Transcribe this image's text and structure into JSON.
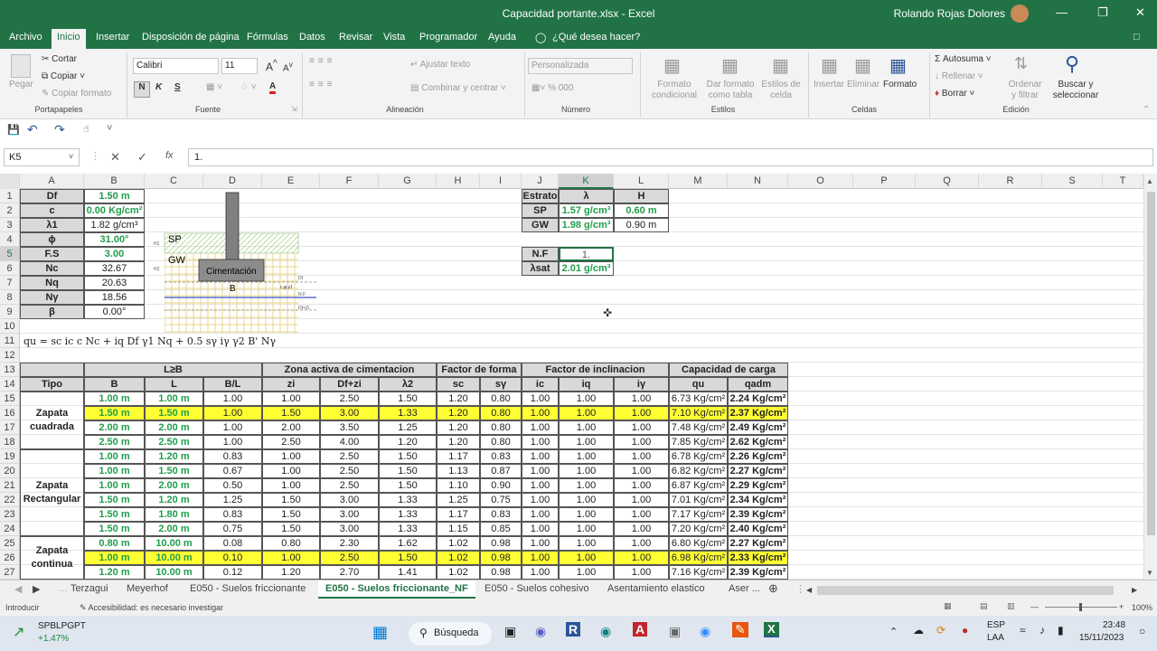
{
  "window": {
    "title": "Capacidad portante.xlsx - Excel",
    "user": "Rolando Rojas Dolores"
  },
  "menu": [
    "Archivo",
    "Inicio",
    "Insertar",
    "Disposición de página",
    "Fórmulas",
    "Datos",
    "Revisar",
    "Vista",
    "Programador",
    "Ayuda",
    "¿Qué desea hacer?"
  ],
  "ribbon": {
    "pegar": "Pegar",
    "cortar": "Cortar",
    "copiar": "Copiar",
    "copiar_formato": "Copiar formato",
    "portapapeles": "Portapapeles",
    "font_name": "Calibri",
    "font_size": "11",
    "fuente": "Fuente",
    "ajustar": "Ajustar texto",
    "combinar": "Combinar y centrar",
    "alineacion": "Alineación",
    "formato_num": "Personalizada",
    "numero": "Número",
    "formato_cond": "Formato condicional",
    "dar_formato": "Dar formato como tabla",
    "estilos_celda": "Estilos de celda",
    "estilos": "Estilos",
    "insertar": "Insertar",
    "eliminar": "Eliminar",
    "formato": "Formato",
    "celdas": "Celdas",
    "autosuma": "Autosuma",
    "rellenar": "Rellenar",
    "borrar": "Borrar",
    "ordenar": "Ordenar y filtrar",
    "buscar": "Buscar y seleccionar",
    "edicion": "Edición"
  },
  "formula_bar": {
    "name_box": "K5",
    "value": "1."
  },
  "columns": [
    "A",
    "B",
    "C",
    "D",
    "E",
    "F",
    "G",
    "H",
    "I",
    "J",
    "K",
    "L",
    "M",
    "N",
    "O",
    "P",
    "Q",
    "R",
    "S",
    "T"
  ],
  "rows": [
    "1",
    "2",
    "3",
    "4",
    "5",
    "6",
    "7",
    "8",
    "9",
    "10",
    "11",
    "12",
    "13",
    "14",
    "15",
    "16",
    "17",
    "18",
    "19",
    "20",
    "21",
    "22",
    "23",
    "24",
    "25",
    "26",
    "27"
  ],
  "params": [
    {
      "label": "Df",
      "value": "1.50 m"
    },
    {
      "label": "c",
      "value": "0.00 Kg/cm²"
    },
    {
      "label": "λ1",
      "value": "1.82 g/cm³"
    },
    {
      "label": "ϕ",
      "value": "31.00°"
    },
    {
      "label": "F.S",
      "value": "3.00"
    },
    {
      "label": "Nc",
      "value": "32.67"
    },
    {
      "label": "Nq",
      "value": "20.63"
    },
    {
      "label": "Nγ",
      "value": "18.56"
    },
    {
      "label": "β",
      "value": "0.00°"
    }
  ],
  "diagram": {
    "sp": "SP",
    "gw": "GW",
    "cimentacion": "Cimentación",
    "b": "B",
    "df": "Df",
    "nf": "N.F",
    "c": "c,φ,γ1",
    "h1": "H1",
    "h2": "H2",
    "dfz": "Df+Zi"
  },
  "formula": "qu = sc ic c Nc + iq Df γ1 Nq + 0.5 sγ iγ γ2 B' Nγ",
  "estrato": {
    "headers": [
      "Estrato",
      "λ",
      "H"
    ],
    "rows": [
      [
        "SP",
        "1.57 g/cm³",
        "0.60 m"
      ],
      [
        "GW",
        "1.98 g/cm³",
        "0.90 m"
      ]
    ]
  },
  "nf": {
    "label": "N.F",
    "value": "1."
  },
  "lsat": {
    "label": "λsat",
    "value": "2.01 g/cm³"
  },
  "table": {
    "group_headers": [
      "L≥B",
      "Zona activa de cimentacion",
      "Factor de forma",
      "Factor de inclinacion",
      "Capacidad de carga"
    ],
    "headers": [
      "Tipo",
      "B",
      "L",
      "B/L",
      "zi",
      "Df+zi",
      "λ2",
      "sc",
      "sγ",
      "ic",
      "iq",
      "iγ",
      "qu",
      "qadm"
    ],
    "types": [
      "Zapata cuadrada",
      "Zapata Rectangular",
      "Zapata continua"
    ],
    "rows": [
      [
        "1.00 m",
        "1.00 m",
        "1.00",
        "1.00",
        "2.50",
        "1.50",
        "1.20",
        "0.80",
        "1.00",
        "1.00",
        "1.00",
        "6.73 Kg/cm²",
        "2.24 Kg/cm²"
      ],
      [
        "1.50 m",
        "1.50 m",
        "1.00",
        "1.50",
        "3.00",
        "1.33",
        "1.20",
        "0.80",
        "1.00",
        "1.00",
        "1.00",
        "7.10 Kg/cm²",
        "2.37 Kg/cm²"
      ],
      [
        "2.00 m",
        "2.00 m",
        "1.00",
        "2.00",
        "3.50",
        "1.25",
        "1.20",
        "0.80",
        "1.00",
        "1.00",
        "1.00",
        "7.48 Kg/cm²",
        "2.49 Kg/cm²"
      ],
      [
        "2.50 m",
        "2.50 m",
        "1.00",
        "2.50",
        "4.00",
        "1.20",
        "1.20",
        "0.80",
        "1.00",
        "1.00",
        "1.00",
        "7.85 Kg/cm²",
        "2.62 Kg/cm²"
      ],
      [
        "1.00 m",
        "1.20 m",
        "0.83",
        "1.00",
        "2.50",
        "1.50",
        "1.17",
        "0.83",
        "1.00",
        "1.00",
        "1.00",
        "6.78 Kg/cm²",
        "2.26 Kg/cm²"
      ],
      [
        "1.00 m",
        "1.50 m",
        "0.67",
        "1.00",
        "2.50",
        "1.50",
        "1.13",
        "0.87",
        "1.00",
        "1.00",
        "1.00",
        "6.82 Kg/cm²",
        "2.27 Kg/cm²"
      ],
      [
        "1.00 m",
        "2.00 m",
        "0.50",
        "1.00",
        "2.50",
        "1.50",
        "1.10",
        "0.90",
        "1.00",
        "1.00",
        "1.00",
        "6.87 Kg/cm²",
        "2.29 Kg/cm²"
      ],
      [
        "1.50 m",
        "1.20 m",
        "1.25",
        "1.50",
        "3.00",
        "1.33",
        "1.25",
        "0.75",
        "1.00",
        "1.00",
        "1.00",
        "7.01 Kg/cm²",
        "2.34 Kg/cm²"
      ],
      [
        "1.50 m",
        "1.80 m",
        "0.83",
        "1.50",
        "3.00",
        "1.33",
        "1.17",
        "0.83",
        "1.00",
        "1.00",
        "1.00",
        "7.17 Kg/cm²",
        "2.39 Kg/cm²"
      ],
      [
        "1.50 m",
        "2.00 m",
        "0.75",
        "1.50",
        "3.00",
        "1.33",
        "1.15",
        "0.85",
        "1.00",
        "1.00",
        "1.00",
        "7.20 Kg/cm²",
        "2.40 Kg/cm²"
      ],
      [
        "0.80 m",
        "10.00 m",
        "0.08",
        "0.80",
        "2.30",
        "1.62",
        "1.02",
        "0.98",
        "1.00",
        "1.00",
        "1.00",
        "6.80 Kg/cm²",
        "2.27 Kg/cm²"
      ],
      [
        "1.00 m",
        "10.00 m",
        "0.10",
        "1.00",
        "2.50",
        "1.50",
        "1.02",
        "0.98",
        "1.00",
        "1.00",
        "1.00",
        "6.98 Kg/cm²",
        "2.33 Kg/cm²"
      ],
      [
        "1.20 m",
        "10.00 m",
        "0.12",
        "1.20",
        "2.70",
        "1.41",
        "1.02",
        "0.98",
        "1.00",
        "1.00",
        "1.00",
        "7.16 Kg/cm²",
        "2.39 Kg/cm²"
      ]
    ]
  },
  "sheets": [
    "Terzagui",
    "Meyerhof",
    "E050 - Suelos friccionante",
    "E050 - Suelos friccionante_NF",
    "E050 - Suelos cohesivo",
    "Asentamiento elastico",
    "Aser ..."
  ],
  "status": {
    "mode": "Introducir",
    "accessibility": "Accesibilidad: es necesario investigar",
    "zoom": "100%"
  },
  "taskbar": {
    "stock": "SPBLPGPT",
    "stock_change": "+1.47%",
    "search": "Búsqueda",
    "lang": "ESP",
    "lang2": "LAA",
    "time": "23:48",
    "date": "15/11/2023"
  },
  "colors": {
    "excel_green": "#217346",
    "value_green": "#1f9e4b",
    "highlight": "#ffff33"
  }
}
